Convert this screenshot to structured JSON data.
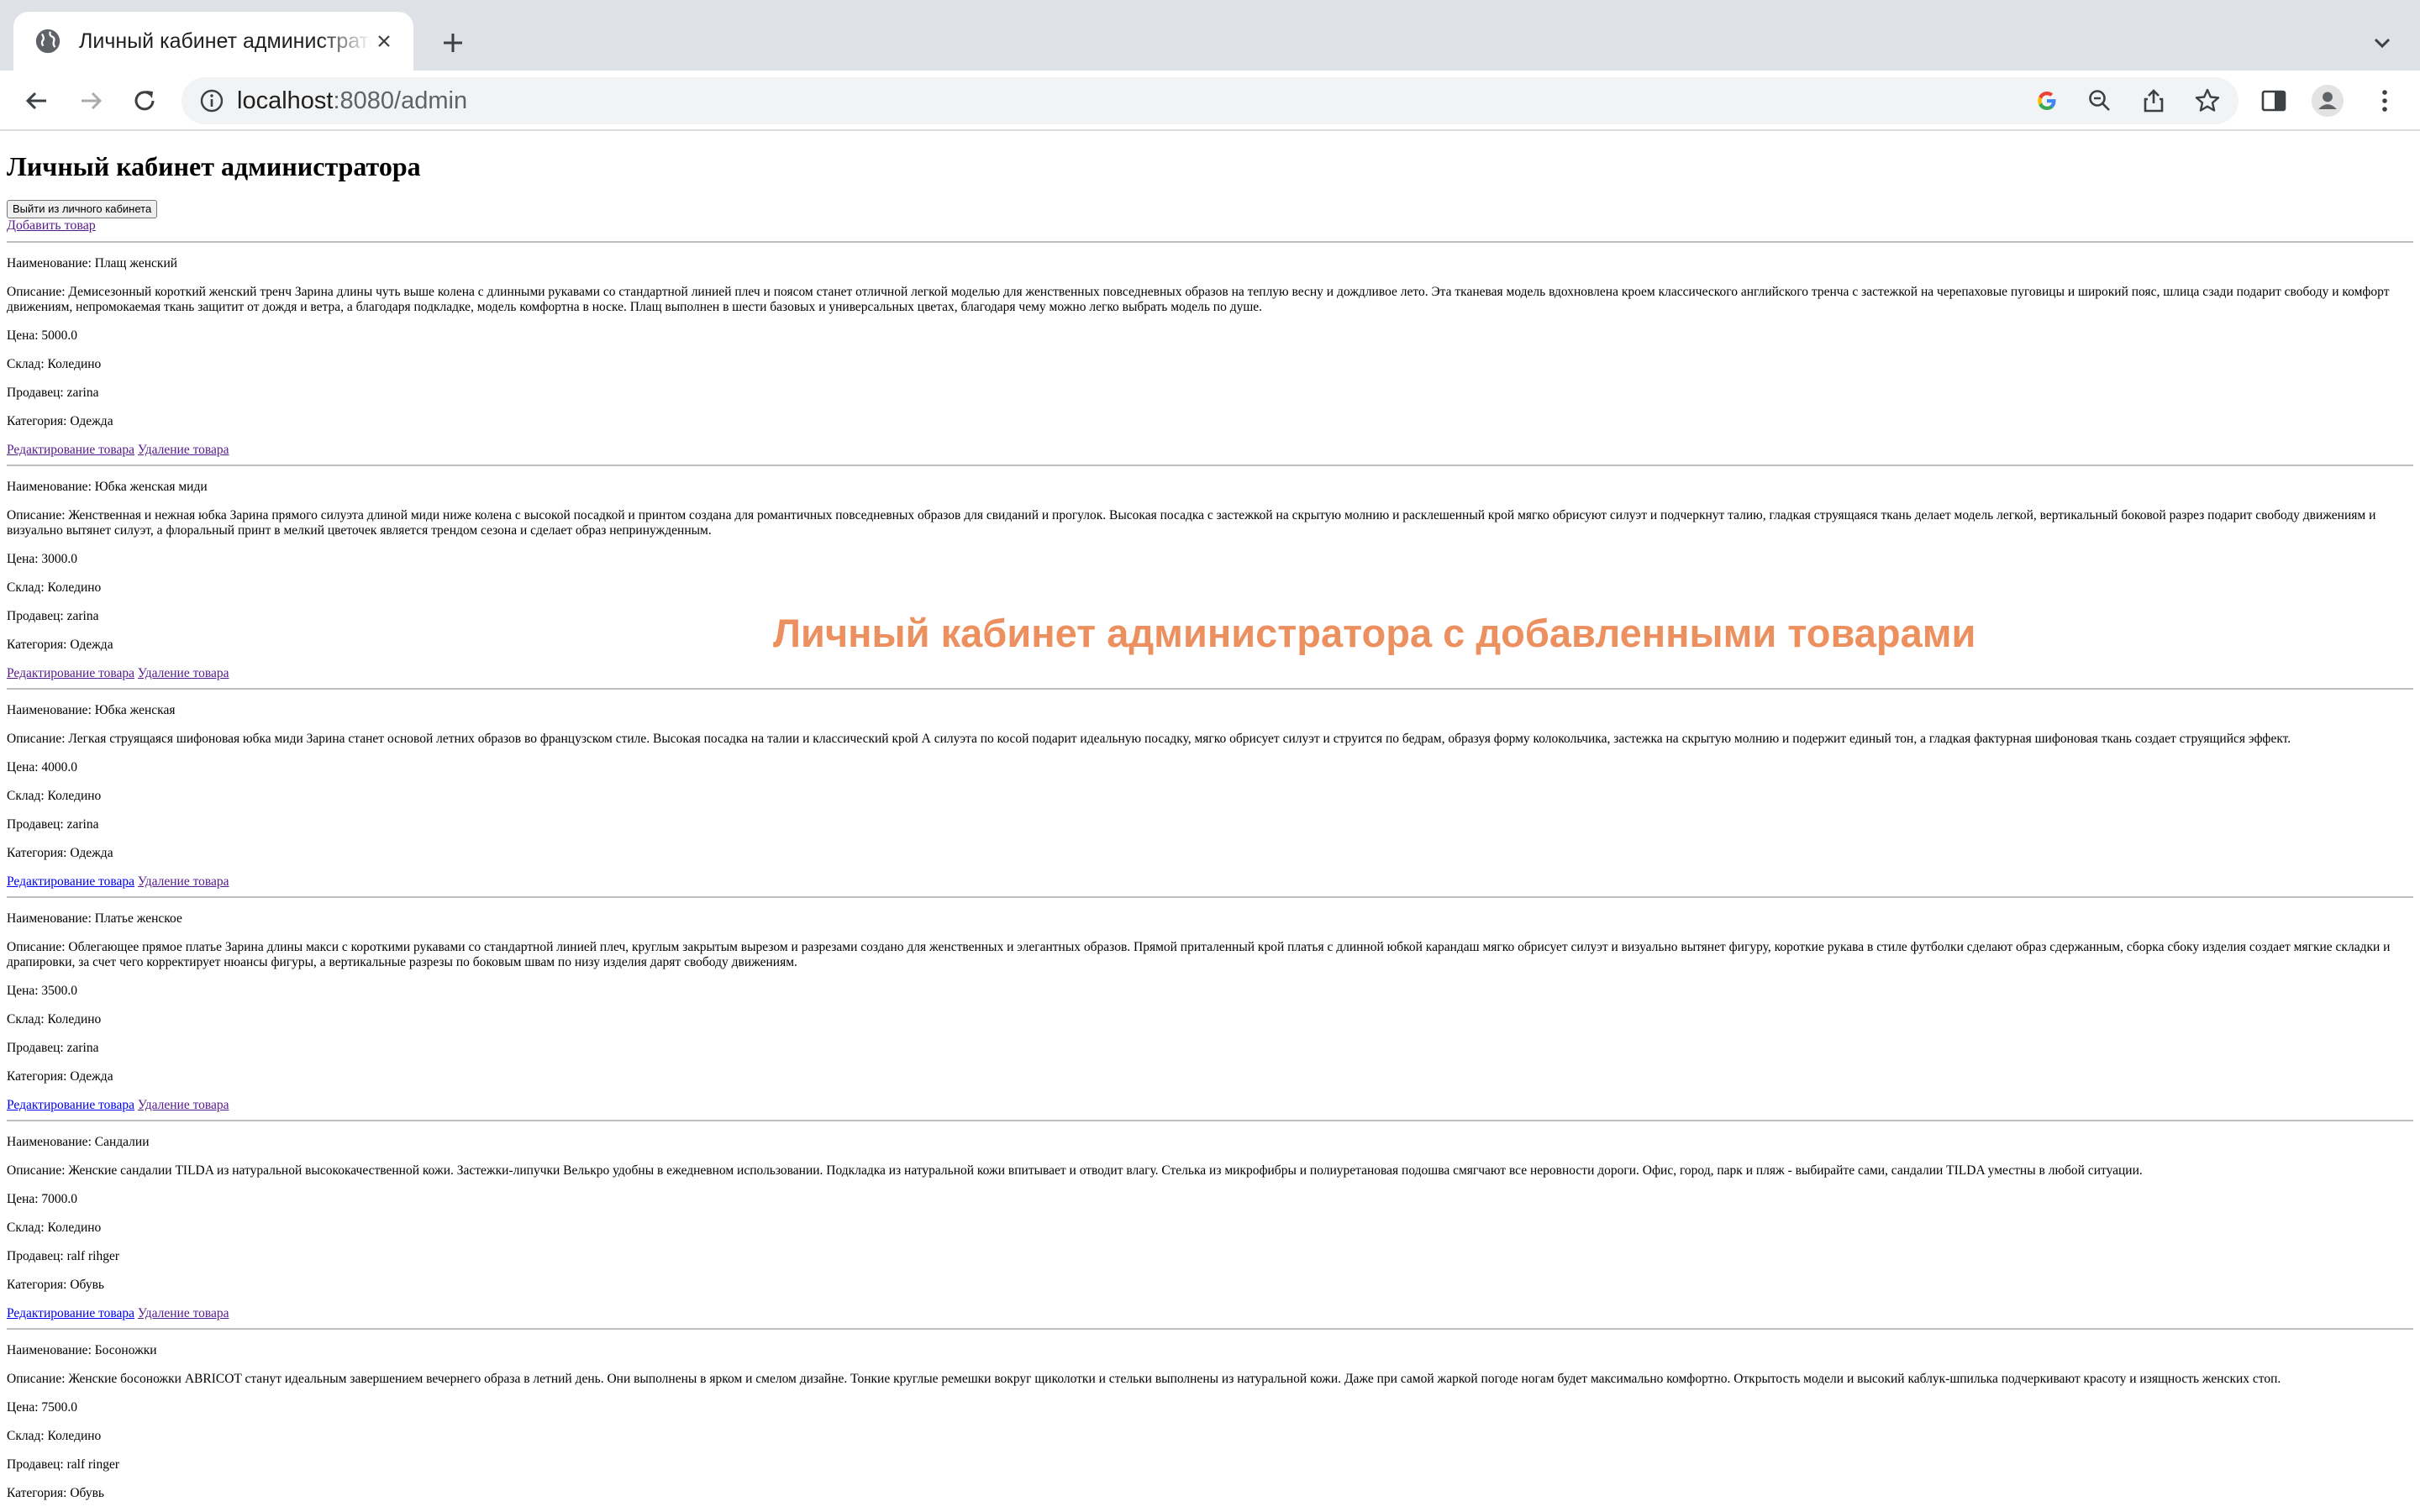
{
  "browser": {
    "tab_title": "Личный кабинет администратора",
    "url_host": "localhost",
    "url_path": ":8080/admin"
  },
  "page": {
    "heading": "Личный кабинет администратора",
    "logout_button": "Выйти из личного кабинета",
    "add_link": "Добавить товар",
    "edit_link": "Редактирование товара",
    "delete_link": "Удаление товара"
  },
  "products": [
    {
      "name": "Наименование: Плащ женский",
      "description": "Описание: Демисезонный короткий женский тренч Зарина длины чуть выше колена с длинными рукавами со стандартной линией плеч и поясом станет отличной легкой моделью для женственных повседневных образов на теплую весну и дождливое лето. Эта тканевая модель вдохновлена кроем классического английского тренча с застежкой на черепаховые пуговицы и широкий пояс, шлица сзади подарит свободу и комфорт движениям, непромокаемая ткань защитит от дождя и ветра, а благодаря подкладке, модель комфортна в носке. Плащ выполнен в шести базовых и универсальных цветах, благодаря чему можно легко выбрать модель по душе.",
      "price": "Цена: 5000.0",
      "warehouse": "Склад: Коледино",
      "seller": "Продавец: zarina",
      "category": "Категория: Одежда"
    },
    {
      "name": "Наименование: Юбка женская миди",
      "description": "Описание: Женственная и нежная юбка Зарина прямого силуэта длиной миди ниже колена с высокой посадкой и принтом создана для романтичных повседневных образов для свиданий и прогулок. Высокая посадка с застежкой на скрытую молнию и расклешенный крой мягко обрисуют силуэт и подчеркнут талию, гладкая струящаяся ткань делает модель легкой, вертикальный боковой разрез подарит свободу движениям и визуально вытянет силуэт, а флоральный принт в мелкий цветочек является трендом сезона и сделает образ непринужденным.",
      "price": "Цена: 3000.0",
      "warehouse": "Склад: Коледино",
      "seller": "Продавец: zarina",
      "category": "Категория: Одежда"
    },
    {
      "name": "Наименование: Юбка женская",
      "description": "Описание: Легкая струящаяся шифоновая юбка миди Зарина станет основой летних образов во французском стиле. Высокая посадка на талии и классический крой А силуэта по косой подарит идеальную посадку, мягко обрисует силуэт и струится по бедрам, образуя форму колокольчика, застежка на скрытую молнию и подержит единый тон, а гладкая фактурная шифоновая ткань создает струящийся эффект.",
      "price": "Цена: 4000.0",
      "warehouse": "Склад: Коледино",
      "seller": "Продавец: zarina",
      "category": "Категория: Одежда"
    },
    {
      "name": "Наименование: Платье женское",
      "description": "Описание: Облегающее прямое платье Зарина длины макси с короткими рукавами со стандартной линией плеч, круглым закрытым вырезом и разрезами создано для женственных и элегантных образов. Прямой приталенный крой платья с длинной юбкой карандаш мягко обрисует силуэт и визуально вытянет фигуру, короткие рукава в стиле футболки сделают образ сдержанным, сборка сбоку изделия создает мягкие складки и драпировки, за счет чего корректирует нюансы фигуры, а вертикальные разрезы по боковым швам по низу изделия дарят свободу движениям.",
      "price": "Цена: 3500.0",
      "warehouse": "Склад: Коледино",
      "seller": "Продавец: zarina",
      "category": "Категория: Одежда"
    },
    {
      "name": "Наименование: Сандалии",
      "description": "Описание: Женские сандалии TILDA из натуральной высококачественной кожи. Застежки-липучки Велькро удобны в ежедневном использовании. Подкладка из натуральной кожи впитывает и отводит влагу. Стелька из микрофибры и полиуретановая подошва смягчают все неровности дороги. Офис, город, парк и пляж - выбирайте сами, сандалии TILDA уместны в любой ситуации.",
      "price": "Цена: 7000.0",
      "warehouse": "Склад: Коледино",
      "seller": "Продавец: ralf rihger",
      "category": "Категория: Обувь"
    },
    {
      "name": "Наименование: Босоножки",
      "description": "Описание: Женские босоножки ABRICOT станут идеальным завершением вечернего образа в летний день. Они выполнены в ярком и смелом дизайне. Тонкие круглые ремешки вокруг щиколотки и стельки выполнены из натуральной кожи. Даже при самой жаркой погоде ногам будет максимально комфортно. Открытость модели и высокий каблук-шпилька подчеркивают красоту и изящность женских стоп.",
      "price": "Цена: 7500.0",
      "warehouse": "Склад: Коледино",
      "seller": "Продавец: ralf ringer",
      "category": "Категория: Обувь"
    }
  ],
  "overlay": {
    "caption": "Личный кабинет администратора с добавленными товарами",
    "color": "#ec9060"
  },
  "icons": [
    "globe-icon",
    "close-icon",
    "plus-icon",
    "chevron-down-icon",
    "back-icon",
    "forward-icon",
    "reload-icon",
    "info-icon",
    "google-icon",
    "zoom-out-icon",
    "share-icon",
    "star-icon",
    "sidebar-icon",
    "profile-icon",
    "menu-icon"
  ]
}
